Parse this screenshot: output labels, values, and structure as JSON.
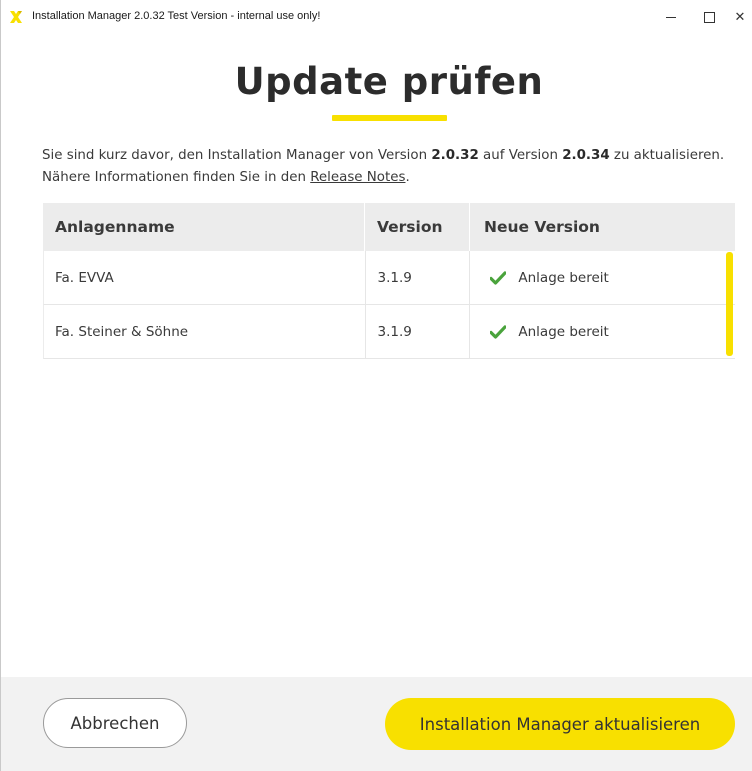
{
  "window": {
    "title": "Installation Manager 2.0.32 Test Version - internal use only!",
    "close_glyph": "✕"
  },
  "header": {
    "title": "Update prüfen"
  },
  "description": {
    "line1_prefix": "Sie sind kurz davor, den Installation Manager von Version ",
    "from_version": "2.0.32",
    "line1_middle": " auf Version ",
    "to_version": "2.0.34",
    "line1_suffix": " zu aktualisieren.",
    "line2_prefix": "Nähere Informationen finden Sie in den ",
    "link_text": "Release Notes",
    "line2_suffix": "."
  },
  "table": {
    "columns": [
      "Anlagenname",
      "Version",
      "Neue Version"
    ],
    "rows": [
      {
        "name": "Fa. EVVA",
        "version": "3.1.9",
        "status": "Anlage bereit",
        "status_icon": "check-icon"
      },
      {
        "name": "Fa. Steiner & Söhne",
        "version": "3.1.9",
        "status": "Anlage bereit",
        "status_icon": "check-icon"
      }
    ]
  },
  "footer": {
    "cancel_label": "Abbrechen",
    "update_label": "Installation Manager aktualisieren"
  },
  "colors": {
    "accent": "#f8e000",
    "check": "#4aa33c",
    "header_bg": "#ececec",
    "footer_bg": "#f2f2f2"
  }
}
